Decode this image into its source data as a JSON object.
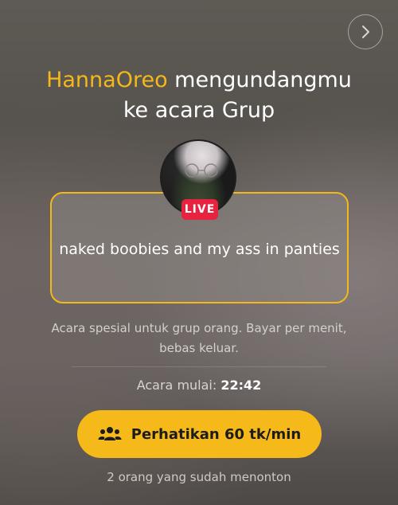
{
  "headline": {
    "host_name": "HannaOreo",
    "line1_rest": " mengundangmu",
    "line2": "ke acara Grup"
  },
  "badge": {
    "live": "LIVE"
  },
  "event": {
    "title": "naked boobies and my ass in panties"
  },
  "description": "Acara spesial untuk grup orang. Bayar per menit, bebas keluar.",
  "start": {
    "label": "Acara mulai: ",
    "time": "22:42"
  },
  "cta": {
    "label": "Perhatikan 60 tk/min",
    "icon": "group-icon"
  },
  "viewers": "2 orang yang sudah menonton",
  "nav": {
    "next_icon": "chevron-right-icon"
  },
  "colors": {
    "accent": "#f5b71a",
    "live": "#e8233f",
    "button": "#f6b91a"
  }
}
